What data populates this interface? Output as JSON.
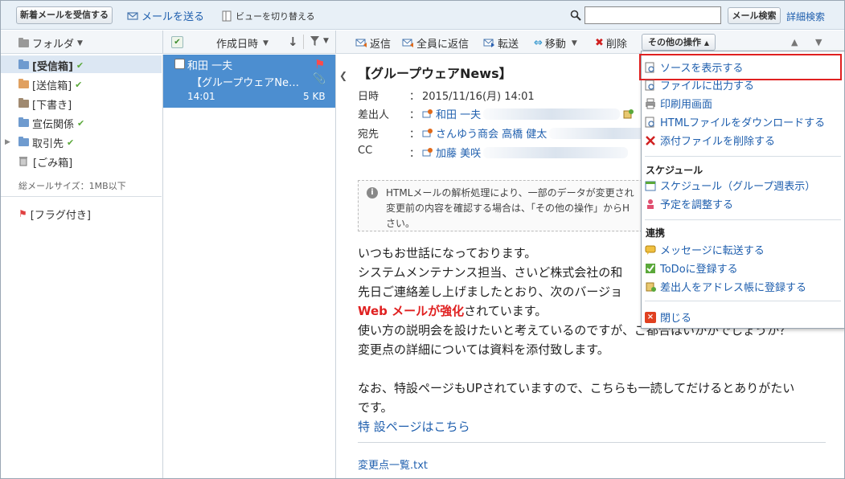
{
  "topbar": {
    "receive_button": "新着メールを受信する",
    "send_mail": "メールを送る",
    "switch_view": "ビューを切り替える",
    "search_value": "",
    "search_button": "メール検索",
    "advanced_search": "詳細検索"
  },
  "folder_pane": {
    "header": "フォルダ",
    "folders": [
      {
        "label": "[受信箱]",
        "checked": true,
        "color": "#6f9bcf"
      },
      {
        "label": "[送信箱]",
        "checked": true,
        "color": "#e0a060"
      },
      {
        "label": "[下書き]",
        "checked": false,
        "color": "#a08a70"
      },
      {
        "label": "宣伝関係",
        "checked": true,
        "color": "#6f9bcf"
      },
      {
        "label": "取引先",
        "checked": true,
        "color": "#6f9bcf"
      },
      {
        "label": "[ごみ箱]",
        "checked": false,
        "color": "#888888"
      }
    ],
    "total_size": "総メールサイズ：1MB以下",
    "flagged": "[フラグ付き]"
  },
  "list_pane": {
    "sort_label": "作成日時",
    "message": {
      "sender": "和田 一夫",
      "subject": "【グループウェアNe…",
      "time": "14:01",
      "size": "5 KB"
    }
  },
  "mail_toolbar": {
    "reply": "返信",
    "reply_all": "全員に返信",
    "forward": "転送",
    "move": "移動",
    "delete": "削除",
    "other_ops": "その他の操作"
  },
  "mail": {
    "subject": "【グループウェアNews】",
    "date_label": "日時",
    "date_value": "2015/11/16(月) 14:01",
    "from_label": "差出人",
    "from_value": "和田 一夫",
    "to_label": "宛先",
    "to_value": "さんゆう商会 高橋 健太",
    "cc_label": "CC",
    "cc_value": "加藤 美咲",
    "colon": "：",
    "notice_line1": "HTMLメールの解析処理により、一部のデータが変更され",
    "notice_line2": "変更前の内容を確認する場合は、「その他の操作」からH",
    "notice_line3": "さい。",
    "body_lines": [
      "いつもお世話になっております。",
      "システムメンテナンス担当、さいど株式会社の和",
      "先日ご連絡差し上げましたとおり、次のバージョ"
    ],
    "highlight_red": "Web メールが強化",
    "highlight_rest": "されています。",
    "body_line5": "使い方の説明会を設けたいと考えているのですが、ご都合はいかがでしょうか？",
    "body_line6": "変更点の詳細については資料を添付致します。",
    "body_line7": "なお、特設ページもUPされていますので、こちらも一読してだけるとありがたい",
    "body_line8": "です。",
    "special_link": "特 設ページはこちら",
    "attachment": "変更点一覧.txt"
  },
  "dropdown": {
    "items_top": [
      {
        "label": "ソースを表示する",
        "icon": "view-source-icon"
      },
      {
        "label": "ファイルに出力する",
        "icon": "export-icon"
      },
      {
        "label": "印刷用画面",
        "icon": "printer-icon"
      },
      {
        "label": "HTMLファイルをダウンロードする",
        "icon": "download-icon"
      },
      {
        "label": "添付ファイルを削除する",
        "icon": "delete-x-icon"
      }
    ],
    "schedule_head": "スケジュール",
    "schedule_items": [
      {
        "label": "スケジュール（グループ週表示）",
        "icon": "calendar-icon"
      },
      {
        "label": "予定を調整する",
        "icon": "adjust-icon"
      }
    ],
    "link_head": "連携",
    "link_items": [
      {
        "label": "メッセージに転送する",
        "icon": "message-icon"
      },
      {
        "label": "ToDoに登録する",
        "icon": "todo-icon"
      },
      {
        "label": "差出人をアドレス帳に登録する",
        "icon": "address-book-icon"
      }
    ],
    "close": "閉じる"
  }
}
